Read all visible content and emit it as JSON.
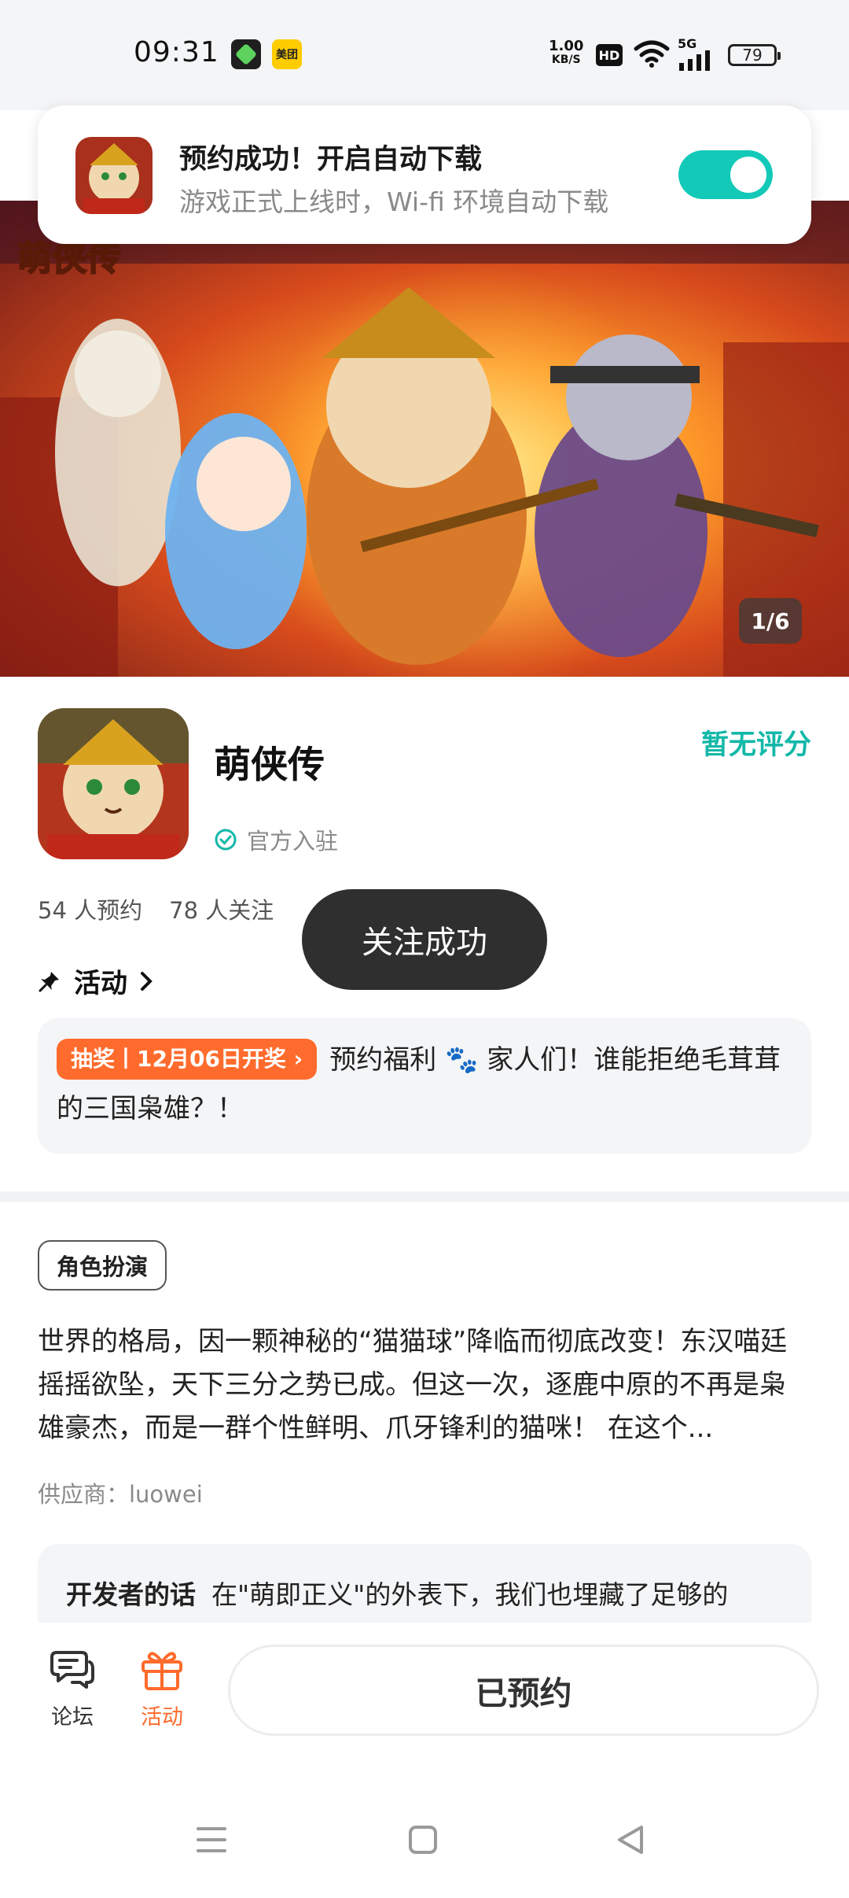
{
  "status_bar": {
    "time": "09:31",
    "app2_label": "美团",
    "net_speed_value": "1.00",
    "net_speed_unit": "KB/S",
    "hd_label": "HD",
    "signal_label": "5G",
    "battery": "79"
  },
  "notification": {
    "title": "预约成功！开启自动下载",
    "subtitle": "游戏正式上线时，Wi-fi 环境自动下载",
    "toggle_on": true,
    "accent_color": "#13c9b8"
  },
  "banner": {
    "logo_text": "萌侠传",
    "counter": "1/6"
  },
  "game": {
    "name": "萌侠传",
    "verified_label": "官方入驻",
    "rating": "暂无评分",
    "reservations": "54 人预约",
    "follows": "78 人关注"
  },
  "toast": {
    "text": "关注成功"
  },
  "activity": {
    "heading": "活动",
    "tag": "抽奖丨12月06日开奖",
    "text_before": "预约福利",
    "text_after": "家人们！谁能拒绝毛茸茸的三国枭雄？！"
  },
  "details": {
    "genre": "角色扮演",
    "description": "世界的格局，因一颗神秘的“猫猫球”降临而彻底改变！东汉喵廷摇摇欲坠，天下三分之势已成。但这一次，逐鹿中原的不再是枭雄豪杰，而是一群个性鲜明、爪牙锋利的猫咪！ 在这个...",
    "supplier": "供应商：luowei",
    "dev_label": "开发者的话",
    "dev_text": "在\"萌即正义\"的外表下，我们也埋藏了足够的"
  },
  "bottom_nav": {
    "forum": "论坛",
    "activity": "活动",
    "reserved": "已预约"
  },
  "colors": {
    "teal": "#13b8a8",
    "orange": "#ff6b2c"
  }
}
